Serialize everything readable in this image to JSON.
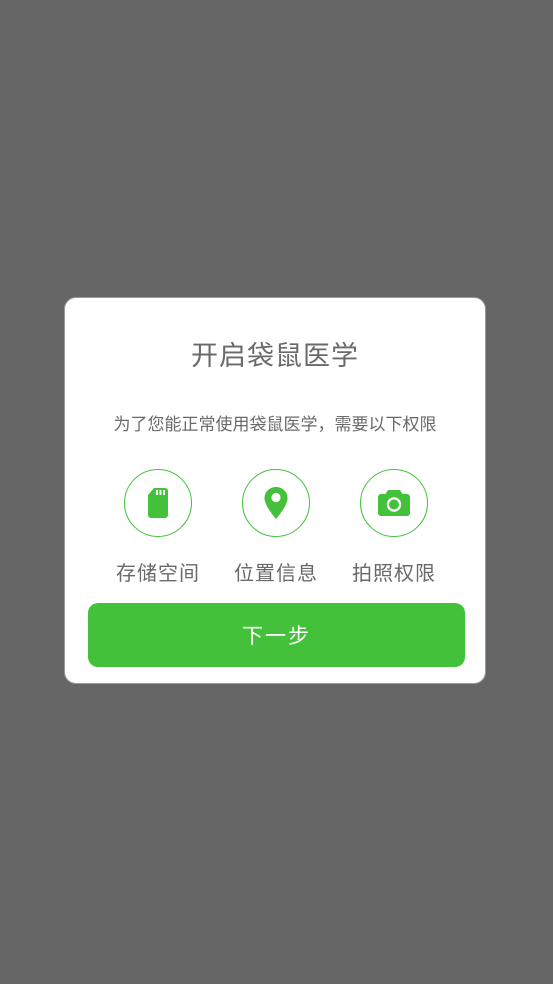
{
  "dialog": {
    "title": "开启袋鼠医学",
    "subtitle": "为了您能正常使用袋鼠医学，需要以下权限",
    "permissions": [
      {
        "label": "存储空间",
        "icon": "sd-card-icon"
      },
      {
        "label": "位置信息",
        "icon": "location-pin-icon"
      },
      {
        "label": "拍照权限",
        "icon": "camera-icon"
      }
    ],
    "next_label": "下一步"
  },
  "colors": {
    "accent": "#44c13a",
    "backdrop": "#666666",
    "text": "#6a6a6a"
  }
}
